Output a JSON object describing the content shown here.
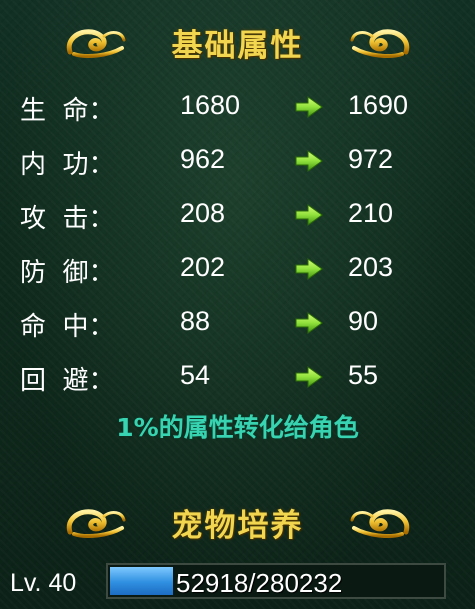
{
  "sections": {
    "basic_title": "基础属性",
    "pet_title": "宠物培养"
  },
  "stats": [
    {
      "label": "生  命：",
      "current": "1680",
      "next": "1690"
    },
    {
      "label": "内  功：",
      "current": "962",
      "next": "972"
    },
    {
      "label": "攻  击：",
      "current": "208",
      "next": "210"
    },
    {
      "label": "防  御：",
      "current": "202",
      "next": "203"
    },
    {
      "label": "命  中：",
      "current": "88",
      "next": "90"
    },
    {
      "label": "回  避：",
      "current": "54",
      "next": "55"
    }
  ],
  "note": "1%的属性转化给角色",
  "level": {
    "label": "Lv. 40",
    "exp_text": "52918/280232",
    "exp_fraction": 0.189
  },
  "colors": {
    "title": "#f2d64f",
    "note": "#38d3b0",
    "arrow": "#8fe03a",
    "exp_fill": "#2f8fe0"
  },
  "icons": {
    "ornament": "golden-cloud-swirl-icon",
    "arrow": "green-right-arrow-icon"
  }
}
